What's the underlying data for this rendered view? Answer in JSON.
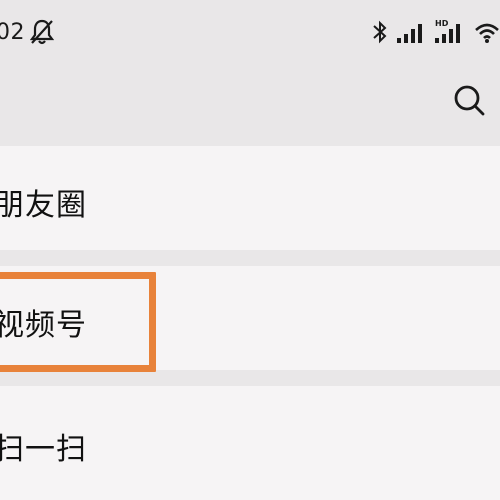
{
  "status_bar": {
    "time": "02",
    "icons": [
      "mute-bell-icon",
      "bluetooth-icon",
      "signal-icon",
      "hd-signal-icon",
      "wifi-icon"
    ]
  },
  "header": {
    "search_icon": "search-icon"
  },
  "menu": {
    "items": [
      {
        "label": "朋友圈"
      },
      {
        "label": "视频号"
      },
      {
        "label": "扫一扫"
      }
    ]
  },
  "highlight": {
    "color": "#e8823a",
    "target": "视频号"
  },
  "colors": {
    "background": "#e9e7e8",
    "item_background": "#f6f4f5",
    "text": "#111111"
  }
}
